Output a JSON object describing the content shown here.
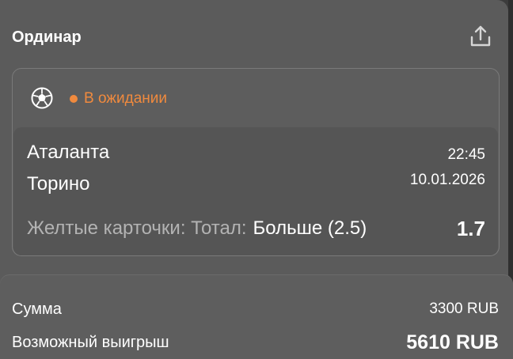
{
  "header": {
    "title": "Ординар"
  },
  "bet": {
    "status": "В ожидании",
    "status_color": "#f08a3e",
    "sport_icon": "soccer-ball-icon",
    "team_home": "Аталанта",
    "team_away": "Торино",
    "time": "22:45",
    "date": "10.01.2026",
    "market": "Желтые карточки",
    "market_sep": ": Тотал:",
    "selection": "Больше (2.5)",
    "odds": "1.7"
  },
  "summary": {
    "amount_label": "Сумма",
    "amount_value": "3300 RUB",
    "win_label": "Возможный выигрыш",
    "win_value": "5610 RUB"
  }
}
